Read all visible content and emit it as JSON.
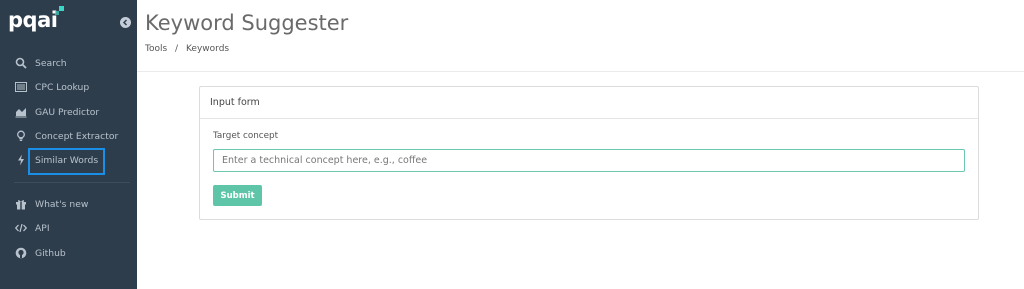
{
  "brand": {
    "name": "pqai",
    "accent": "#3dd6c6"
  },
  "sidebar": {
    "items": [
      {
        "label": "Search",
        "icon": "search-icon"
      },
      {
        "label": "CPC Lookup",
        "icon": "list-icon"
      },
      {
        "label": "GAU Predictor",
        "icon": "area-chart-icon"
      },
      {
        "label": "Concept Extractor",
        "icon": "lightbulb-icon"
      },
      {
        "label": "Similar Words",
        "icon": "bolt-icon"
      }
    ],
    "secondary": [
      {
        "label": "What's new",
        "icon": "gift-icon"
      },
      {
        "label": "API",
        "icon": "code-icon"
      },
      {
        "label": "Github",
        "icon": "github-icon"
      }
    ],
    "highlight_color": "#1a8fe8"
  },
  "header": {
    "title": "Keyword Suggester",
    "breadcrumb": [
      "Tools",
      "/",
      "Keywords"
    ]
  },
  "form": {
    "title": "Input form",
    "field_label": "Target concept",
    "input_value": "",
    "input_placeholder": "Enter a technical concept here, e.g., coffee",
    "submit_label": "Submit",
    "submit_color": "#5fc5a8"
  }
}
